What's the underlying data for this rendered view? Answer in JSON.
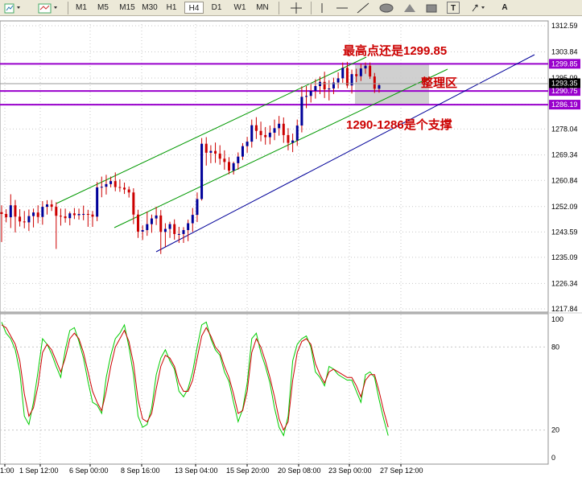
{
  "toolbar": {
    "periods": [
      "M1",
      "M5",
      "M15",
      "M30",
      "H1",
      "H4",
      "D1",
      "W1",
      "MN"
    ],
    "active_period": "H4",
    "text_tool_label": "T",
    "label_tool_label": "A"
  },
  "colors": {
    "candle": "#cc0000",
    "grid": "#c8c8c8",
    "level_line": "#9900cc",
    "channel_green": "#009900",
    "channel_blue": "#000099",
    "annotation": "#cc0000",
    "stoch_main": "#00cc00",
    "stoch_signal": "#cc0000"
  },
  "chart_data": [
    {
      "type": "candlestick",
      "symbol_timeframe": "H4",
      "price_scale": [
        "1312.59",
        "1303.84",
        "1295.09",
        "1286.34",
        "1278.04",
        "1269.34",
        "1260.84",
        "1252.09",
        "1243.59",
        "1235.09",
        "1226.34",
        "1217.84"
      ],
      "ylim": [
        1217.84,
        1312.59
      ],
      "x_labels": [
        "1:00",
        "1 Sep 12:00",
        "6 Sep 00:00",
        "8 Sep 16:00",
        "13 Sep 04:00",
        "15 Sep 20:00",
        "20 Sep 08:00",
        "23 Sep 00:00",
        "27 Sep 12:00"
      ],
      "current_price": "1293.35",
      "price_tags": [
        "1299.85",
        "1290.75",
        "1286.19"
      ],
      "horizontal_levels": [
        1299.85,
        1290.75,
        1286.19
      ],
      "annotations": {
        "high_text": "最高点还是1299.85",
        "range_text": "整理区",
        "support_text": "1290-1286是个支撑"
      },
      "candles": [
        [
          1250.2,
          1252.5,
          1240.2,
          1249.6
        ],
        [
          1249.6,
          1251.2,
          1246.8,
          1248.5
        ],
        [
          1248.5,
          1256.2,
          1244.9,
          1252.5
        ],
        [
          1252.5,
          1254.3,
          1243.4,
          1248.7
        ],
        [
          1248.7,
          1251.2,
          1245.4,
          1247.1
        ],
        [
          1247.1,
          1250.6,
          1244.8,
          1246.8
        ],
        [
          1246.8,
          1251.1,
          1243.9,
          1248.9
        ],
        [
          1248.9,
          1251.4,
          1245.1,
          1250.1
        ],
        [
          1250.1,
          1252.5,
          1246.5,
          1248.6
        ],
        [
          1248.6,
          1253.9,
          1246.0,
          1252.0
        ],
        [
          1252.0,
          1254.2,
          1249.4,
          1252.8
        ],
        [
          1252.8,
          1254.3,
          1250.6,
          1252.0
        ],
        [
          1252.0,
          1253.5,
          1237.9,
          1249.0
        ],
        [
          1249.0,
          1251.4,
          1245.7,
          1248.8
        ],
        [
          1248.8,
          1251.4,
          1246.7,
          1248.2
        ],
        [
          1248.2,
          1250.4,
          1245.8,
          1249.8
        ],
        [
          1249.8,
          1251.6,
          1247.9,
          1249.2
        ],
        [
          1249.2,
          1251.4,
          1247.7,
          1249.6
        ],
        [
          1249.6,
          1252.4,
          1247.5,
          1249.6
        ],
        [
          1249.6,
          1251.0,
          1245.3,
          1249.4
        ],
        [
          1249.4,
          1250.6,
          1245.3,
          1248.7
        ],
        [
          1248.7,
          1260.3,
          1247.2,
          1258.5
        ],
        [
          1258.5,
          1262.1,
          1255.2,
          1258.7
        ],
        [
          1258.7,
          1262.7,
          1256.1,
          1259.6
        ],
        [
          1259.6,
          1262.1,
          1258.5,
          1260.6
        ],
        [
          1260.6,
          1263.5,
          1257.2,
          1258.6
        ],
        [
          1258.6,
          1261.2,
          1257.0,
          1258.4
        ],
        [
          1258.4,
          1260.1,
          1256.3,
          1257.8
        ],
        [
          1257.8,
          1258.8,
          1255.1,
          1256.8
        ],
        [
          1256.8,
          1258.2,
          1246.2,
          1249.4
        ],
        [
          1249.4,
          1251.0,
          1241.6,
          1243.7
        ],
        [
          1243.7,
          1245.8,
          1240.9,
          1244.2
        ],
        [
          1244.2,
          1250.4,
          1242.3,
          1246.2
        ],
        [
          1246.2,
          1249.4,
          1243.3,
          1248.1
        ],
        [
          1248.1,
          1252.0,
          1245.9,
          1249.1
        ],
        [
          1249.1,
          1250.9,
          1236.2,
          1243.6
        ],
        [
          1243.6,
          1246.5,
          1238.6,
          1244.6
        ],
        [
          1244.6,
          1247.0,
          1241.6,
          1246.2
        ],
        [
          1246.2,
          1247.8,
          1241.0,
          1242.9
        ],
        [
          1242.9,
          1245.3,
          1239.9,
          1242.9
        ],
        [
          1242.9,
          1245.2,
          1239.9,
          1244.2
        ],
        [
          1244.2,
          1247.7,
          1240.5,
          1246.5
        ],
        [
          1246.5,
          1251.6,
          1243.6,
          1249.3
        ],
        [
          1249.3,
          1256.8,
          1246.9,
          1254.6
        ],
        [
          1254.6,
          1275.0,
          1254.1,
          1273.1
        ],
        [
          1273.1,
          1275.3,
          1265.8,
          1270.1
        ],
        [
          1270.1,
          1272.6,
          1266.6,
          1270.7
        ],
        [
          1270.7,
          1273.5,
          1266.7,
          1269.8
        ],
        [
          1269.8,
          1272.6,
          1266.1,
          1268.1
        ],
        [
          1268.1,
          1270.9,
          1264.4,
          1267.0
        ],
        [
          1267.0,
          1268.6,
          1262.9,
          1264.1
        ],
        [
          1264.1,
          1267.1,
          1262.8,
          1266.6
        ],
        [
          1266.6,
          1270.2,
          1264.4,
          1268.8
        ],
        [
          1268.8,
          1273.3,
          1267.7,
          1272.3
        ],
        [
          1272.3,
          1275.4,
          1270.1,
          1273.8
        ],
        [
          1273.8,
          1281.2,
          1271.8,
          1279.3
        ],
        [
          1279.3,
          1282.0,
          1274.7,
          1277.4
        ],
        [
          1277.4,
          1280.5,
          1273.9,
          1276.0
        ],
        [
          1276.0,
          1278.7,
          1272.8,
          1275.3
        ],
        [
          1275.3,
          1279.2,
          1272.9,
          1276.8
        ],
        [
          1276.8,
          1281.2,
          1274.3,
          1278.3
        ],
        [
          1278.3,
          1282.4,
          1275.8,
          1279.8
        ],
        [
          1279.8,
          1281.9,
          1273.4,
          1276.0
        ],
        [
          1276.0,
          1278.3,
          1270.9,
          1273.4
        ],
        [
          1273.4,
          1276.5,
          1270.3,
          1274.2
        ],
        [
          1274.2,
          1281.2,
          1272.4,
          1279.2
        ],
        [
          1279.2,
          1292.3,
          1276.9,
          1288.8
        ],
        [
          1288.8,
          1292.4,
          1285.0,
          1289.1
        ],
        [
          1289.1,
          1293.3,
          1286.9,
          1290.8
        ],
        [
          1290.8,
          1294.7,
          1288.2,
          1292.4
        ],
        [
          1292.4,
          1295.6,
          1289.7,
          1293.8
        ],
        [
          1293.8,
          1297.2,
          1288.4,
          1291.3
        ],
        [
          1291.3,
          1294.4,
          1287.6,
          1291.6
        ],
        [
          1291.6,
          1295.2,
          1289.7,
          1293.6
        ],
        [
          1293.6,
          1297.0,
          1291.6,
          1295.0
        ],
        [
          1295.0,
          1300.3,
          1293.5,
          1298.5
        ],
        [
          1298.5,
          1300.5,
          1291.7,
          1292.6
        ],
        [
          1292.6,
          1297.9,
          1289.9,
          1296.4
        ],
        [
          1296.4,
          1298.2,
          1293.7,
          1295.7
        ],
        [
          1295.7,
          1299.9,
          1294.1,
          1298.3
        ],
        [
          1298.3,
          1300.3,
          1296.5,
          1299.2
        ],
        [
          1299.2,
          1300.3,
          1294.8,
          1295.6
        ],
        [
          1295.6,
          1296.8,
          1290.1,
          1291.5
        ],
        [
          1291.5,
          1293.4,
          1290.2,
          1292.7
        ]
      ]
    },
    {
      "type": "line",
      "indicator": "stochastic",
      "ylim": [
        0,
        100
      ],
      "scale_labels": [
        "100",
        "80",
        "20",
        "0"
      ],
      "levels": [
        80,
        20
      ],
      "series": [
        {
          "values": [
            98,
            90,
            86,
            78,
            62,
            30,
            24,
            40,
            62,
            86,
            82,
            75,
            66,
            58,
            78,
            92,
            94,
            84,
            72,
            55,
            40,
            38,
            32,
            58,
            74,
            86,
            90,
            96,
            80,
            60,
            30,
            22,
            24,
            36,
            60,
            72,
            78,
            70,
            64,
            48,
            44,
            50,
            62,
            80,
            96,
            98,
            86,
            78,
            74,
            62,
            55,
            40,
            26,
            35,
            54,
            86,
            90,
            76,
            66,
            54,
            36,
            22,
            16,
            30,
            70,
            82,
            86,
            88,
            80,
            62,
            58,
            52,
            66,
            64,
            60,
            58,
            56,
            56,
            48,
            40,
            60,
            62,
            58,
            42,
            28,
            16
          ]
        },
        {
          "values": [
            96,
            94,
            88,
            82,
            70,
            46,
            30,
            36,
            52,
            76,
            82,
            78,
            70,
            62,
            72,
            86,
            90,
            86,
            76,
            62,
            48,
            40,
            34,
            48,
            66,
            80,
            86,
            92,
            84,
            68,
            42,
            28,
            26,
            32,
            50,
            66,
            74,
            72,
            66,
            54,
            48,
            48,
            56,
            72,
            88,
            94,
            88,
            80,
            76,
            66,
            58,
            46,
            32,
            34,
            48,
            76,
            86,
            80,
            70,
            58,
            44,
            28,
            20,
            26,
            56,
            76,
            84,
            86,
            82,
            68,
            60,
            54,
            62,
            64,
            62,
            60,
            58,
            58,
            52,
            44,
            56,
            60,
            60,
            48,
            34,
            22
          ]
        }
      ]
    }
  ]
}
